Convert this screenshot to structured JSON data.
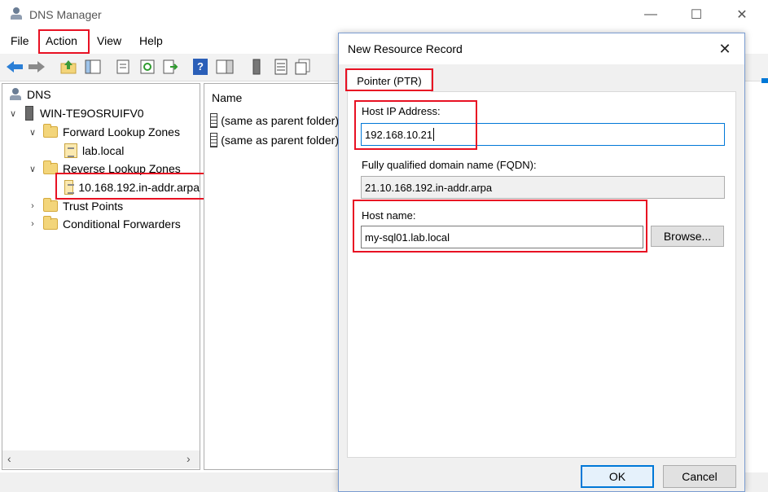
{
  "window": {
    "title": "DNS Manager",
    "minimize_glyph": "—",
    "maximize_glyph": "☐",
    "close_glyph": "✕"
  },
  "menu": [
    "File",
    "Action",
    "View",
    "Help"
  ],
  "toolbar": {
    "icons": [
      "back-icon",
      "forward-icon",
      "up-folder-icon",
      "show-hide-console-tree-icon",
      "properties-icon",
      "refresh-icon",
      "export-list-icon",
      "help-icon",
      "show-action-pane-icon",
      "server-icon",
      "record-list-icon",
      "new-record-icon"
    ],
    "help_glyph": "?"
  },
  "tree": {
    "root": "DNS",
    "server": "WIN-TE9OSRUIFV0",
    "forward_zones": "Forward Lookup Zones",
    "forward_child": "lab.local",
    "reverse_zones": "Reverse Lookup Zones",
    "reverse_child": "10.168.192.in-addr.arpa",
    "trust_points": "Trust Points",
    "conditional_forwarders": "Conditional Forwarders"
  },
  "list": {
    "column_name": "Name",
    "rows": [
      "(same as parent folder)",
      "(same as parent folder)"
    ]
  },
  "dialog": {
    "title": "New Resource Record",
    "tab": "Pointer (PTR)",
    "host_ip_label": "Host IP Address:",
    "host_ip_value": "192.168.10.21",
    "fqdn_label": "Fully qualified domain name (FQDN):",
    "fqdn_value": "21.10.168.192.in-addr.arpa",
    "host_name_label": "Host name:",
    "host_name_value": "my-sql01.lab.local",
    "browse_label": "Browse...",
    "ok_label": "OK",
    "cancel_label": "Cancel"
  },
  "colors": {
    "highlight": "#e81123",
    "accent": "#0078d7"
  }
}
